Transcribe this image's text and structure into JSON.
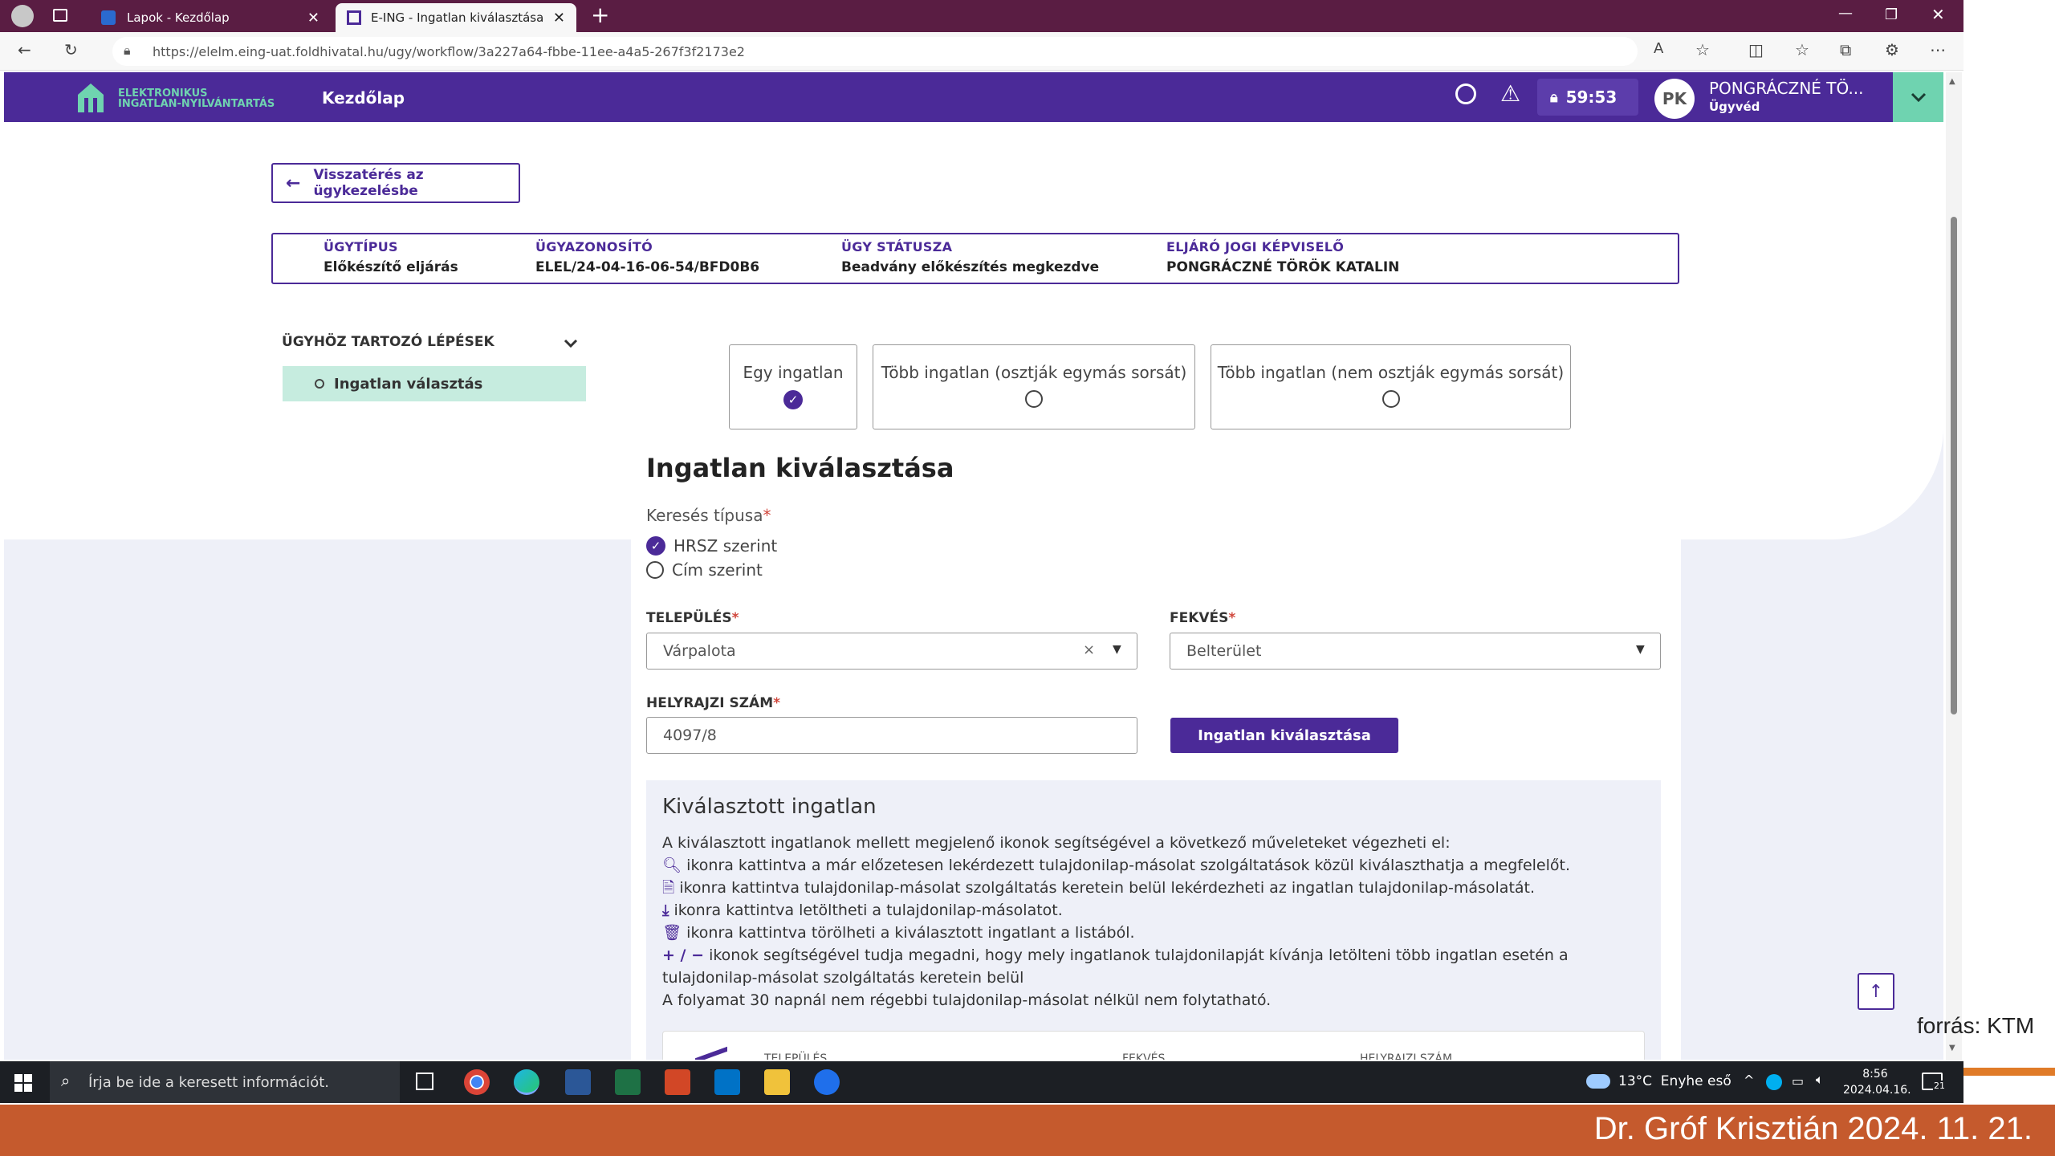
{
  "browser": {
    "tabs": [
      {
        "label": "Lapok - Kezdőlap",
        "active": false
      },
      {
        "label": "E-ING - Ingatlan kiválasztása",
        "active": true
      }
    ],
    "url": "https://elelm.eing-uat.foldhivatal.hu/ugy/workflow/3a227a64-fbbe-11ee-a4a5-267f3f2173e2"
  },
  "header": {
    "logo_line1": "ELEKTRONIKUS",
    "logo_line2": "INGATLAN-NYILVÁNTARTÁS",
    "nav_home": "Kezdőlap",
    "timer": "59:53",
    "avatar_initials": "PK",
    "user_name": "PONGRÁCZNÉ TÖ...",
    "user_role": "Ügyvéd"
  },
  "back_button": "Visszatérés az ügykezelésbe",
  "case_info": [
    {
      "label": "ÜGYTÍPUS",
      "value": "Előkészítő eljárás"
    },
    {
      "label": "ÜGYAZONOSÍTÓ",
      "value": "ELEL/24-04-16-06-54/BFD0B6"
    },
    {
      "label": "ÜGY STÁTUSZA",
      "value": "Beadvány előkészítés megkezdve"
    },
    {
      "label": "ELJÁRÓ JOGI KÉPVISELŐ",
      "value": "PONGRÁCZNÉ TÖRÖK KATALIN"
    }
  ],
  "steps": {
    "title": "ÜGYHÖZ TARTOZÓ LÉPÉSEK",
    "items": [
      "Ingatlan választás"
    ]
  },
  "options": [
    {
      "label": "Egy ingatlan",
      "selected": true
    },
    {
      "label": "Több ingatlan (osztják egymás sorsát)",
      "selected": false
    },
    {
      "label": "Több ingatlan (nem osztják egymás sorsát)",
      "selected": false
    }
  ],
  "section_title": "Ingatlan kiválasztása",
  "search_type": {
    "label": "Keresés típusa",
    "options": [
      {
        "label": "HRSZ szerint",
        "selected": true
      },
      {
        "label": "Cím szerint",
        "selected": false
      }
    ]
  },
  "fields": {
    "telepules_label": "TELEPÜLÉS",
    "telepules_value": "Várpalota",
    "fekves_label": "FEKVÉS",
    "fekves_value": "Belterület",
    "hrsz_label": "HELYRAJZI SZÁM",
    "hrsz_value": "4097/8"
  },
  "select_button": "Ingatlan kiválasztása",
  "selected_box": {
    "title": "Kiválasztott ingatlan",
    "intro": "A kiválasztott ingatlanok mellett megjelenő ikonok segítségével a következő műveleteket végezheti el:",
    "lines": [
      "ikonra kattintva a már előzetesen lekérdezett tulajdonilap-másolat szolgáltatások közül kiválaszthatja a megfelelőt.",
      "ikonra kattintva tulajdonilap-másolat szolgáltatás keretein belül lekérdezheti az ingatlan tulajdonilap-másolatát.",
      "ikonra kattintva letöltheti a tulajdonilap-másolatot.",
      "ikonra kattintva törölheti a kiválasztott ingatlant a listából.",
      "ikonok segítségével tudja megadni, hogy mely ingatlanok tulajdonilapját kívánja letölteni több ingatlan esetén a",
      "tulajdonilap-másolat szolgáltatás keretein belül"
    ],
    "plusminus": "+ / −",
    "note": "A folyamat 30 napnál nem régebbi tulajdonilap-másolat nélkül nem folytatható.",
    "table_headers": [
      "TELEPÜLÉS",
      "FEKVÉS",
      "HELYRAJZI SZÁM"
    ]
  },
  "taskbar": {
    "search_placeholder": "Írja be ide a keresett információt.",
    "weather": "13°C  Enyhe eső",
    "time": "8:56",
    "date": "2024.04.16.",
    "notif_count": "21"
  },
  "slide": {
    "source": "forrás: KTM",
    "footer": "Dr. Gróf Krisztián 2024. 11. 21."
  },
  "colors": {
    "brand": "#4b2a98",
    "accent_green": "#6fd3b0",
    "step_highlight": "#c6ecdf",
    "footer": "#c55a2d"
  }
}
